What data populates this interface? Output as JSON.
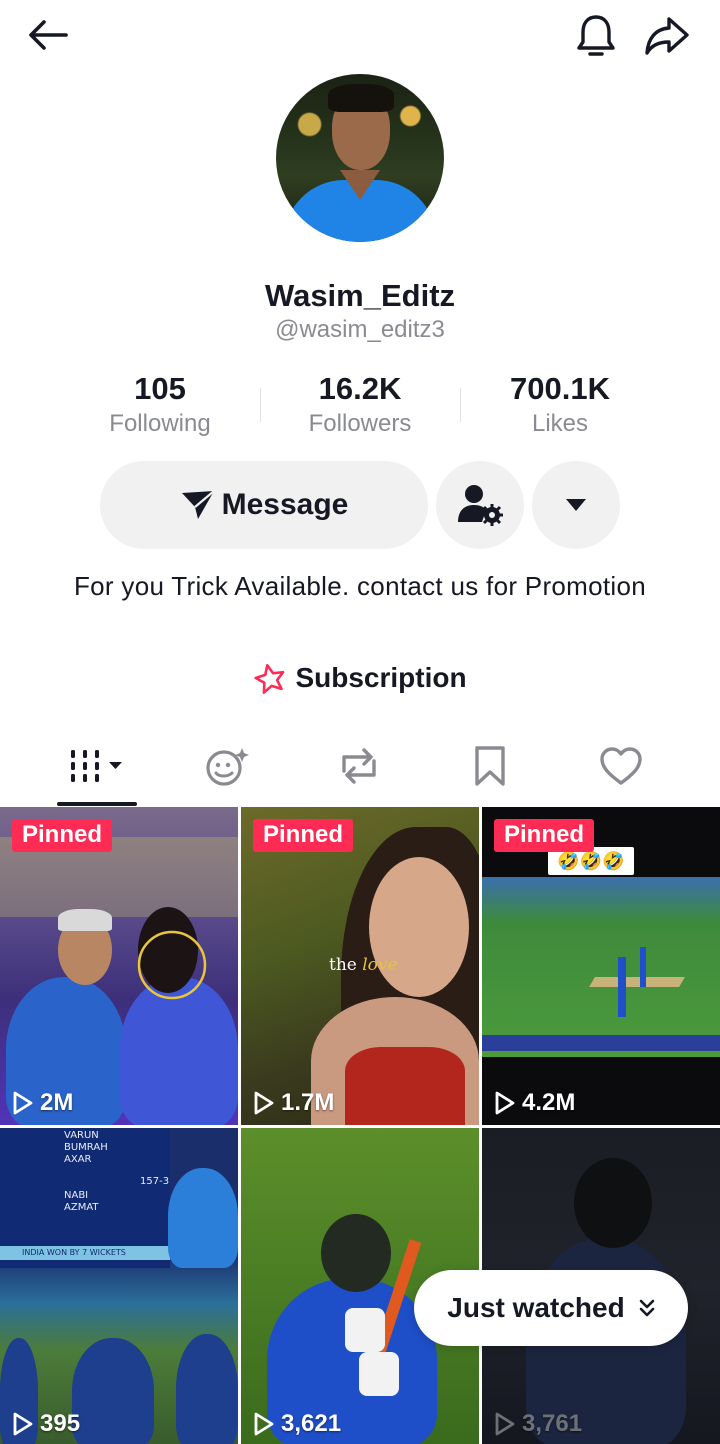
{
  "profile": {
    "display_name": "Wasim_Editz",
    "handle": "@wasim_editz3",
    "bio": "For you Trick Available. contact us for Promotion"
  },
  "stats": [
    {
      "value": "105",
      "label": "Following"
    },
    {
      "value": "16.2K",
      "label": "Followers"
    },
    {
      "value": "700.1K",
      "label": "Likes"
    }
  ],
  "actions": {
    "message_label": "Message"
  },
  "subscription": {
    "label": "Subscription",
    "icon": "star-icon",
    "icon_color": "#fe2c55"
  },
  "tabs": [
    {
      "name": "videos",
      "icon": "grid-icon",
      "active": true
    },
    {
      "name": "collab",
      "icon": "collab-icon"
    },
    {
      "name": "reposts",
      "icon": "repost-icon"
    },
    {
      "name": "favorites",
      "icon": "bookmark-icon"
    },
    {
      "name": "liked",
      "icon": "heart-icon"
    }
  ],
  "videos": [
    {
      "pinned_label": "Pinned",
      "views": "2M"
    },
    {
      "pinned_label": "Pinned",
      "views": "1.7M",
      "caption_a": "the",
      "caption_b": "love"
    },
    {
      "pinned_label": "Pinned",
      "views": "4.2M",
      "caption_emoji": "🤣🤣🤣"
    },
    {
      "views": "395",
      "scoreboard_lines": [
        "VARUN",
        "BUMRAH",
        "AXAR",
        "157-3",
        "NABI",
        "AZMAT",
        "INDIA WON BY 7 WICKETS"
      ]
    },
    {
      "views": "3,621"
    },
    {
      "views": "3,761"
    }
  ],
  "just_watched": {
    "label": "Just watched"
  },
  "colors": {
    "accent": "#fe2c55",
    "text_primary": "#161823",
    "text_secondary": "#8a8b91",
    "button_bg": "#f1f1f2"
  }
}
